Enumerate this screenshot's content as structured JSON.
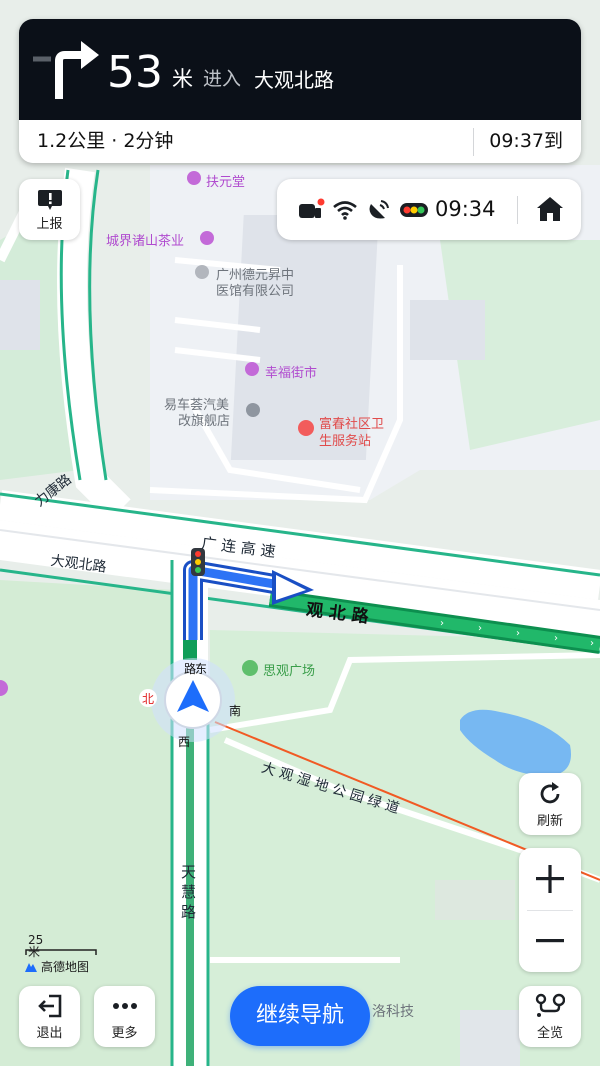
{
  "guidance": {
    "distance_value": "53",
    "distance_unit": "米",
    "action_text": "进入",
    "road_name": "大观北路",
    "remaining": "1.2公里 · 2分钟",
    "arrival": "09:37到"
  },
  "status": {
    "clock": "09:34",
    "icons": [
      "car-icon",
      "wifi-icon",
      "satellite-icon",
      "traffic-light-icon"
    ]
  },
  "buttons": {
    "report": "上报",
    "refresh": "刷新",
    "exit": "退出",
    "more": "更多",
    "continue": "继续导航",
    "overview": "全览"
  },
  "map": {
    "pois": [
      "扶元堂",
      "城界诸山茶业",
      "广州德元昇中",
      "医馆有限公司",
      "幸福街市",
      "易车荟汽美",
      "改旗舰店",
      "富春社区卫",
      "生服务站",
      "思观广场"
    ],
    "roads": {
      "guanglian_expressway": "广 连 高 速",
      "daguan_north_left": "大观北路",
      "daguan_north_right": "观 北 路",
      "likang": "力康路",
      "tianhui": "天慧路",
      "greenway": "大 观 湿 地 公 园 绿 道",
      "bottom_partial": "洛科技"
    },
    "compass": {
      "north": "北",
      "east": "东",
      "south": "南",
      "west": "西",
      "extra": "路"
    },
    "scale": "25米",
    "logo": "高德地图"
  },
  "colors": {
    "accent": "#1d6dfb",
    "route_green": "#0f9d58",
    "dark_panel": "#0b1018"
  }
}
